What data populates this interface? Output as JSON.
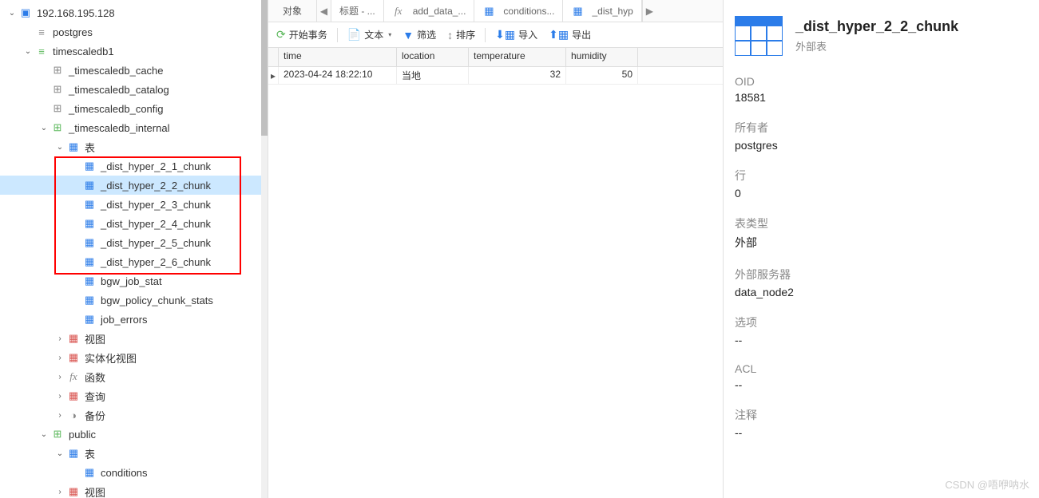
{
  "sidebar": {
    "server": "192.168.195.128",
    "postgres": "postgres",
    "db": "timescaledb1",
    "schemas": {
      "cache": "_timescaledb_cache",
      "catalog": "_timescaledb_catalog",
      "config": "_timescaledb_config",
      "internal": "_timescaledb_internal",
      "public": "public"
    },
    "internal_tables_label": "表",
    "chunks": [
      "_dist_hyper_2_1_chunk",
      "_dist_hyper_2_2_chunk",
      "_dist_hyper_2_3_chunk",
      "_dist_hyper_2_4_chunk",
      "_dist_hyper_2_5_chunk",
      "_dist_hyper_2_6_chunk"
    ],
    "internal_other": {
      "bgw_job_stat": "bgw_job_stat",
      "bgw_policy": "bgw_policy_chunk_stats",
      "job_errors": "job_errors"
    },
    "folders": {
      "views": "视图",
      "matviews": "实体化视图",
      "functions": "函数",
      "queries": "查询",
      "backup": "备份"
    },
    "public_tables": {
      "label": "表",
      "conditions": "conditions"
    }
  },
  "tabs": {
    "object": "对象",
    "title": "标题 - ...",
    "add": "add_data_...",
    "conditions": "conditions...",
    "dist": "_dist_hyp"
  },
  "toolbar": {
    "begin_tx": "开始事务",
    "text": "文本",
    "filter": "筛选",
    "sort": "排序",
    "import": "导入",
    "export": "导出"
  },
  "grid": {
    "headers": {
      "time": "time",
      "location": "location",
      "temperature": "temperature",
      "humidity": "humidity"
    },
    "rows": [
      {
        "time": "2023-04-24 18:22:10",
        "location": "当地",
        "temperature": "32",
        "humidity": "50"
      }
    ]
  },
  "inspector": {
    "title": "_dist_hyper_2_2_chunk",
    "subtitle": "外部表",
    "props": {
      "oid_l": "OID",
      "oid_v": "18581",
      "owner_l": "所有者",
      "owner_v": "postgres",
      "rows_l": "行",
      "rows_v": "0",
      "type_l": "表类型",
      "type_v": "外部",
      "server_l": "外部服务器",
      "server_v": "data_node2",
      "options_l": "选项",
      "options_v": "--",
      "acl_l": "ACL",
      "acl_v": "--",
      "comment_l": "注释",
      "comment_v": "--"
    }
  },
  "watermark": "CSDN @唔咿呐水"
}
